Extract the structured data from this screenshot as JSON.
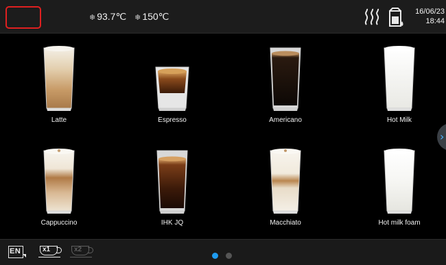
{
  "status": {
    "temperatures": [
      "93.7℃",
      "150℃"
    ],
    "date": "16/06/23",
    "time": "18:44",
    "icons": [
      "menu-highlight",
      "snowflake-icon",
      "steam-heat-icon",
      "milk-container-icon"
    ]
  },
  "drinks": [
    {
      "label": "Latte",
      "kind": "latte",
      "glass": "tall"
    },
    {
      "label": "Espresso",
      "kind": "espresso",
      "glass": "shot"
    },
    {
      "label": "Americano",
      "kind": "americano",
      "glass": "tall"
    },
    {
      "label": "Hot Milk",
      "kind": "milk",
      "glass": "tall"
    },
    {
      "label": "Cappuccino",
      "kind": "cappuccino",
      "glass": "tall"
    },
    {
      "label": "IHK JQ",
      "kind": "long-black",
      "glass": "tall"
    },
    {
      "label": "Macchiato",
      "kind": "macchiato",
      "glass": "tall"
    },
    {
      "label": "Hot milk foam",
      "kind": "milk-foam",
      "glass": "tall"
    }
  ],
  "bottom": {
    "language": "EN",
    "cup_single": "x1",
    "cup_double": "x2",
    "pages": 2,
    "active_page": 1
  },
  "colors": {
    "accent": "#1e9bf0",
    "inactive_dot": "#555555",
    "highlight_border": "#e02020"
  }
}
